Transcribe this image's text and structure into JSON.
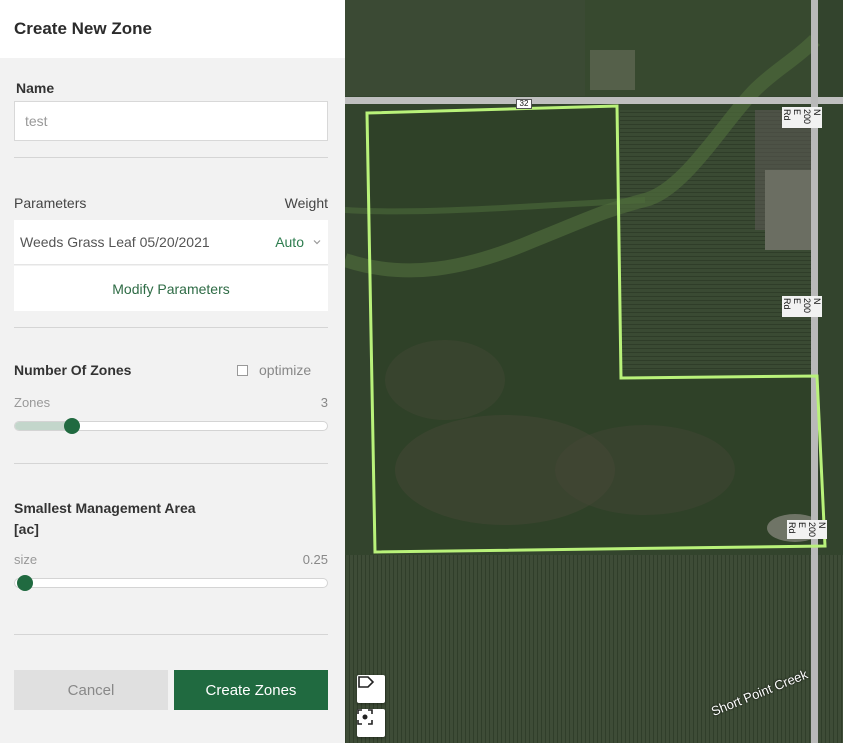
{
  "panel": {
    "title": "Create New Zone",
    "name_label": "Name",
    "name_value": "test",
    "parameters_label": "Parameters",
    "weight_label": "Weight",
    "parameter_row": {
      "name": "Weeds Grass Leaf 05/20/2021",
      "weight": "Auto"
    },
    "modify_button": "Modify Parameters",
    "zones_section": {
      "title": "Number Of Zones",
      "optimize_label": "optimize",
      "optimize_checked": false,
      "slider_label": "Zones",
      "slider_value": "3",
      "slider_fraction": 0.16
    },
    "sma_section": {
      "title_line1": "Smallest Management Area",
      "title_line2": "[ac]",
      "slider_label": "size",
      "slider_value": "0.25",
      "slider_fraction": 0.0
    },
    "cancel_button": "Cancel",
    "create_button": "Create Zones"
  },
  "map": {
    "route_shield": "32",
    "road_label_top": "N 200 E Rd",
    "road_label_mid": "N 200 E Rd",
    "road_label_bottom": "N 200 E Rd",
    "creek_label": "Short Point Creek",
    "boundary_color": "#b9f27a",
    "controls": [
      "label-icon",
      "fit-bounds-icon"
    ]
  },
  "colors": {
    "accent": "#206a40",
    "accent_light": "#c3d6cb"
  }
}
